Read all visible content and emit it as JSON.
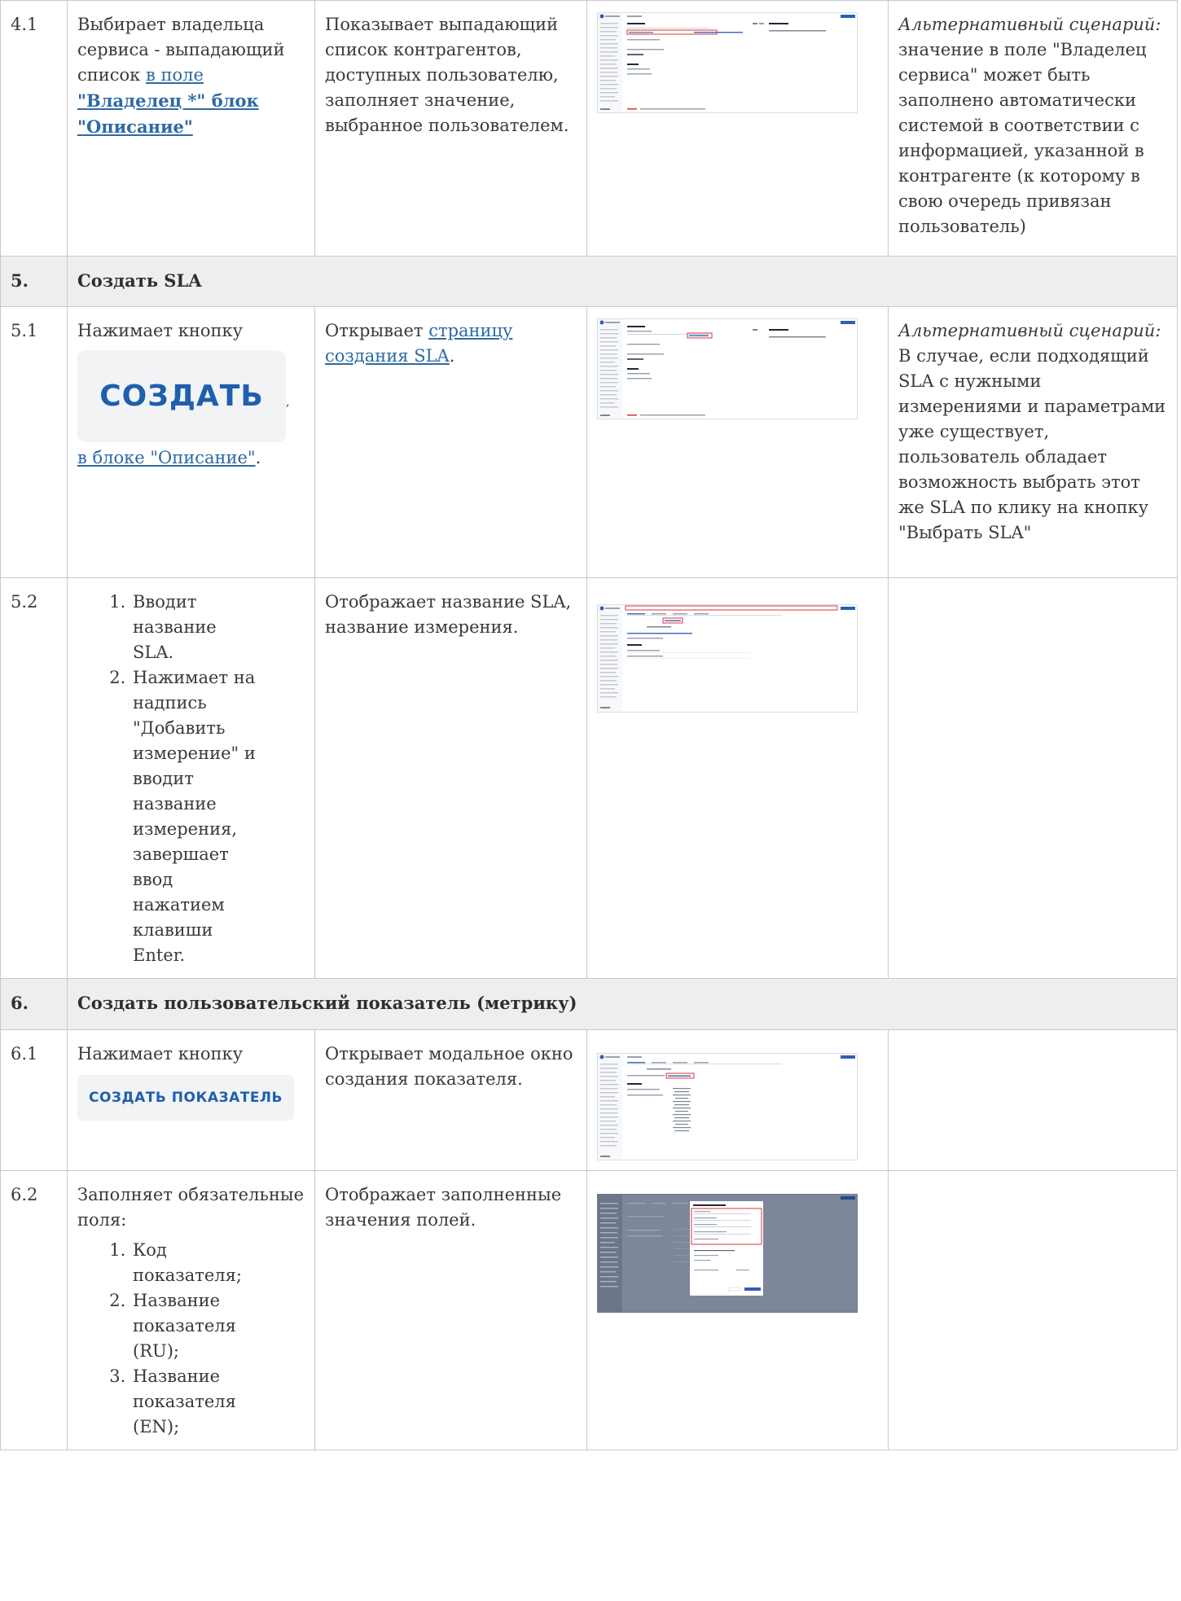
{
  "rows": [
    {
      "num": "4.1",
      "user_action_1": "Выбирает владельца сервиса - выпадающий список ",
      "user_link_1": "в поле",
      "user_link_2": "\"Владелец *\" блок \"Описание\"",
      "system_text": "Показывает выпадающий список контрагентов, доступных пользователю, заполняет значение, выбранное пользователем.",
      "note_italic": "Альтернативный сценарий:",
      "note_text": " значение в поле \"Владелец сервиса\" может быть заполнено автоматически системой в соответствии с информацией, указанной в контрагенте (к которому в свою очередь привязан пользователь)"
    },
    {
      "section_num": "5.",
      "section_title": "Создать SLA"
    },
    {
      "num": "5.1",
      "user_action_1": "Нажимает кнопку",
      "button_label": "СОЗДАТЬ",
      "comma": ",",
      "user_link_1": "в блоке \"Описание\"",
      "period": ".",
      "system_text_1": "Открывает ",
      "system_link": "страницу создания SLA",
      "system_text_2": ".",
      "note_italic": "Альтернативный сценарий:",
      "note_text": "В случае, если подходящий SLA с нужными измерениями и параметрами уже существует, пользователь обладает возможность выбрать этот же SLA по клику на кнопку \"Выбрать SLA\""
    },
    {
      "num": "5.2",
      "steps": [
        "Вводит название SLA.",
        "Нажимает на надпись \"Добавить измерение\" и вводит название измерения, завершает ввод нажатием клавиши Enter."
      ],
      "system_text": "Отображает название SLA, название измерения."
    },
    {
      "section_num": "6.",
      "section_title": "Создать пользовательский показатель (метрику)"
    },
    {
      "num": "6.1",
      "user_action_1": "Нажимает кнопку",
      "button_label": "СОЗДАТЬ ПОКАЗАТЕЛЬ",
      "system_text": "Открывает модальное окно создания показателя."
    },
    {
      "num": "6.2",
      "user_action_1": "Заполняет обязательные поля:",
      "steps": [
        "Код показателя;",
        "Название показателя (RU);",
        "Название показателя (EN);"
      ],
      "system_text": "Отображает заполненные значения полей."
    }
  ],
  "colors": {
    "border": "#c9c9c9",
    "section_bg": "#eceeef",
    "link": "#2d6aa3",
    "button_text": "#1f5fad",
    "button_bg": "#f2f3f5",
    "highlight": "#e0303a",
    "modal_overlay": "#7d8799"
  }
}
